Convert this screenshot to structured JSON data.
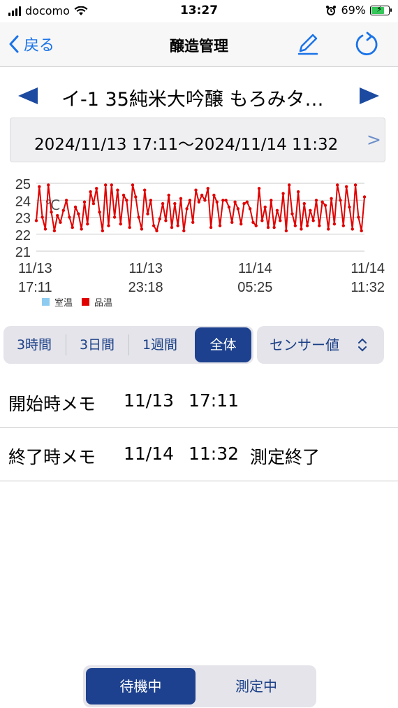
{
  "status_bar": {
    "carrier": "docomo",
    "time": "13:27",
    "battery": "69%"
  },
  "nav": {
    "back_label": "戻る",
    "title": "醸造管理"
  },
  "sake": {
    "name": "イ-1 35純米大吟醸  もろみタ…"
  },
  "range": {
    "text": "2024/11/13  17:11〜2024/11/14  11:32",
    "next": ">"
  },
  "colors": {
    "accent": "#1d418e",
    "link": "#1a73e8",
    "series_room": "#8ecbf0",
    "series_product": "#e00000"
  },
  "chart_data": {
    "type": "line",
    "unit_label": "℃",
    "ylim": [
      21,
      25
    ],
    "yticks": [
      21,
      22,
      23,
      24,
      25
    ],
    "xticks": [
      {
        "line1": "11/13",
        "line2": "17:11"
      },
      {
        "line1": "11/13",
        "line2": "23:18"
      },
      {
        "line1": "11/14",
        "line2": "05:25"
      },
      {
        "line1": "11/14",
        "line2": "11:32"
      }
    ],
    "legend": [
      "室温",
      "品温"
    ],
    "series": [
      {
        "name": "室温",
        "values": []
      },
      {
        "name": "品温",
        "values": [
          22.8,
          24.8,
          23.0,
          22.3,
          24.9,
          23.3,
          22.2,
          23.1,
          22.7,
          23.4,
          24.0,
          23.0,
          22.4,
          23.6,
          23.2,
          22.3,
          23.9,
          22.6,
          24.5,
          23.8,
          24.7,
          23.3,
          22.2,
          24.9,
          22.5,
          24.9,
          23.0,
          24.6,
          22.6,
          24.3,
          24.0,
          22.4,
          24.9,
          24.2,
          23.0,
          22.3,
          24.6,
          23.2,
          24.0,
          22.5,
          22.2,
          22.9,
          23.8,
          22.8,
          24.3,
          22.4,
          23.8,
          22.5,
          24.1,
          22.2,
          23.5,
          24.0,
          22.7,
          24.6,
          23.9,
          24.3,
          24.0,
          24.7,
          22.4,
          24.3,
          23.9,
          22.5,
          24.0,
          24.0,
          23.6,
          22.7,
          23.9,
          23.5,
          22.6,
          23.8,
          23.9,
          23.5,
          22.7,
          22.5,
          24.7,
          22.8,
          23.6,
          22.4,
          24.0,
          22.4,
          23.4,
          22.8,
          24.4,
          22.2,
          24.9,
          23.2,
          22.5,
          24.5,
          22.3,
          23.8,
          22.5,
          23.4,
          22.8,
          24.0,
          22.5,
          23.9,
          23.7,
          22.3,
          24.1,
          22.6,
          24.9,
          24.0,
          22.5,
          24.8,
          23.6,
          22.3,
          24.9,
          23.0,
          22.2,
          24.2
        ]
      }
    ]
  },
  "segment": {
    "items": [
      "3時間",
      "3日間",
      "1週間",
      "全体"
    ],
    "active_index": 3
  },
  "sensor_select": {
    "value": "センサー値",
    "icon": "chevron-up-down-icon"
  },
  "memos": [
    {
      "label": "開始時メモ",
      "date": "11/13",
      "time": "17:11",
      "note": ""
    },
    {
      "label": "終了時メモ",
      "date": "11/14",
      "time": "11:32",
      "note": "測定終了"
    }
  ],
  "bottom_toggle": {
    "options": [
      "待機中",
      "測定中"
    ],
    "active_index": 0
  }
}
